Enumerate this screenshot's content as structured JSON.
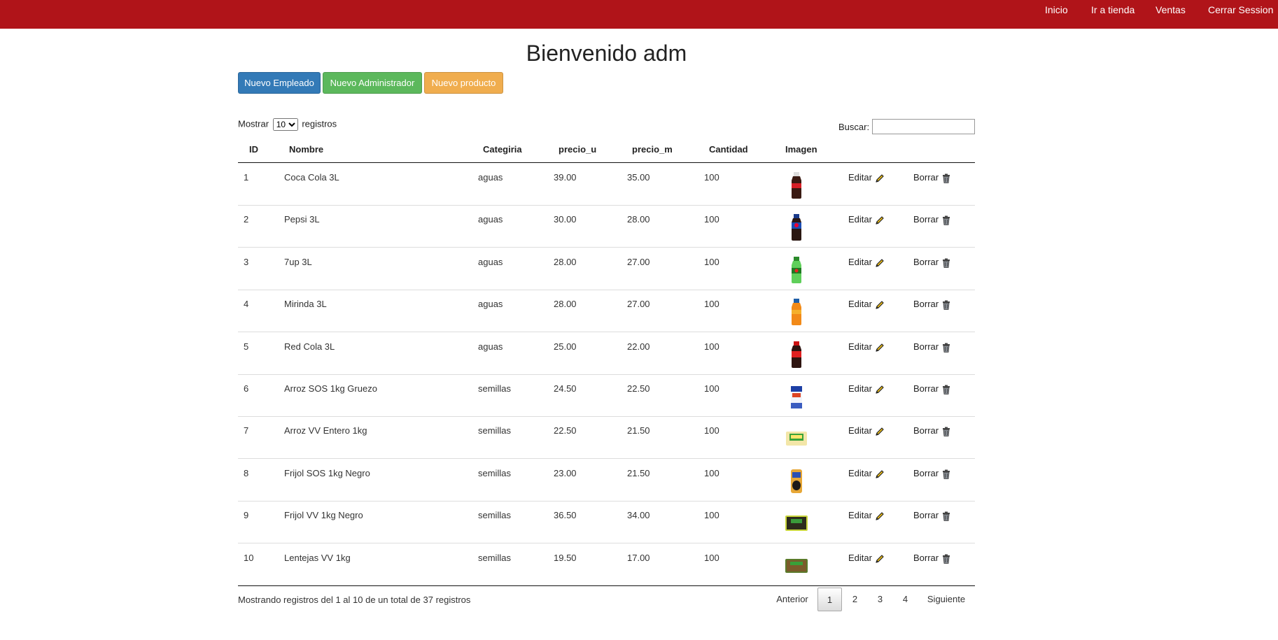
{
  "nav": {
    "links": [
      "Inicio",
      "Ir a tienda",
      "Ventas",
      "Cerrar Session"
    ]
  },
  "page": {
    "title": "Bienvenido adm"
  },
  "actions": {
    "new_employee": "Nuevo Empleado",
    "new_admin": "Nuevo Administrador",
    "new_product": "Nuevo producto"
  },
  "length_menu": {
    "prefix": "Mostrar",
    "value": "10",
    "options": [
      "10"
    ],
    "suffix": "registros"
  },
  "search": {
    "label": "Buscar:",
    "value": ""
  },
  "table": {
    "headers": [
      "ID",
      "Nombre",
      "Categiria",
      "precio_u",
      "precio_m",
      "Cantidad",
      "Imagen"
    ],
    "edit_label": "Editar",
    "delete_label": "Borrar",
    "rows": [
      {
        "id": "1",
        "nombre": "Coca Cola 3L",
        "categoria": "aguas",
        "precio_u": "39.00",
        "precio_m": "35.00",
        "cantidad": "100",
        "image_icon": "cola-bottle-icon"
      },
      {
        "id": "2",
        "nombre": "Pepsi 3L",
        "categoria": "aguas",
        "precio_u": "30.00",
        "precio_m": "28.00",
        "cantidad": "100",
        "image_icon": "pepsi-bottle-icon"
      },
      {
        "id": "3",
        "nombre": "7up 3L",
        "categoria": "aguas",
        "precio_u": "28.00",
        "precio_m": "27.00",
        "cantidad": "100",
        "image_icon": "green-bottle-icon"
      },
      {
        "id": "4",
        "nombre": "Mirinda 3L",
        "categoria": "aguas",
        "precio_u": "28.00",
        "precio_m": "27.00",
        "cantidad": "100",
        "image_icon": "orange-bottle-icon"
      },
      {
        "id": "5",
        "nombre": "Red Cola 3L",
        "categoria": "aguas",
        "precio_u": "25.00",
        "precio_m": "22.00",
        "cantidad": "100",
        "image_icon": "red-cola-bottle-icon"
      },
      {
        "id": "6",
        "nombre": "Arroz SOS 1kg Gruezo",
        "categoria": "semillas",
        "precio_u": "24.50",
        "precio_m": "22.50",
        "cantidad": "100",
        "image_icon": "rice-bag-icon"
      },
      {
        "id": "7",
        "nombre": "Arroz VV Entero 1kg",
        "categoria": "semillas",
        "precio_u": "22.50",
        "precio_m": "21.50",
        "cantidad": "100",
        "image_icon": "rice-package-icon"
      },
      {
        "id": "8",
        "nombre": "Frijol SOS 1kg Negro",
        "categoria": "semillas",
        "precio_u": "23.00",
        "precio_m": "21.50",
        "cantidad": "100",
        "image_icon": "bean-bag-icon"
      },
      {
        "id": "9",
        "nombre": "Frijol VV 1kg Negro",
        "categoria": "semillas",
        "precio_u": "36.50",
        "precio_m": "34.00",
        "cantidad": "100",
        "image_icon": "bean-package-icon"
      },
      {
        "id": "10",
        "nombre": "Lentejas VV 1kg",
        "categoria": "semillas",
        "precio_u": "19.50",
        "precio_m": "17.00",
        "cantidad": "100",
        "image_icon": "lentil-package-icon"
      }
    ]
  },
  "footer": {
    "info": "Mostrando registros del 1 al 10 de un total de 37 registros",
    "prev": "Anterior",
    "pages": [
      "1",
      "2",
      "3",
      "4"
    ],
    "current_page": "1",
    "next": "Siguiente"
  },
  "colors": {
    "navbar": "#b01419",
    "primary": "#337ab7",
    "success": "#5cb85c",
    "warning": "#f0ad4e"
  }
}
